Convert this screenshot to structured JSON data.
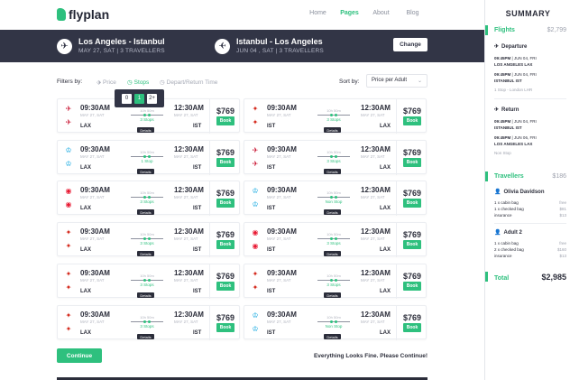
{
  "brand": "flyplan",
  "nav": [
    "Home",
    "Pages",
    "About",
    "Blog"
  ],
  "route_out": {
    "title": "Los Angeles - Istanbul",
    "date": "MAY 27, SAT",
    "travellers": "3 TRAVELLERS"
  },
  "route_back": {
    "title": "Istanbul - Los Angeles",
    "date": "JUN 04 , SAT",
    "travellers": "3 TRAVELLERS"
  },
  "change_label": "Change",
  "filters": {
    "label": "Filters by:",
    "price": "Price",
    "stops": "Stops",
    "depart": "Depart/Return Time",
    "sort_label": "Sort by:",
    "sort_value": "Price per Adult"
  },
  "stop_options": [
    "0",
    "1",
    "2+"
  ],
  "cards": [
    {
      "airline": "Turkish",
      "icon": "plane-tail-icon",
      "time_a": "09:30AM",
      "time_b": "12:30AM",
      "date": "MAY 27, SAT",
      "from": "LAX",
      "to": "IST",
      "duration": "10h 50m",
      "stops": "3 Stops",
      "details": "Details",
      "price": "$769",
      "book": "Book"
    },
    {
      "airline": "Air Canada",
      "icon": "maple-leaf-icon",
      "time_a": "09:30AM",
      "time_b": "12:30AM",
      "date": "MAY 27, SAT",
      "from": "IST",
      "to": "LAX",
      "duration": "10h 50m",
      "stops": "3 Stops",
      "details": "Details",
      "price": "$769",
      "book": "Book"
    },
    {
      "airline": "KLM",
      "icon": "klm-icon",
      "time_a": "09:30AM",
      "time_b": "12:30AM",
      "date": "MAY 27, SAT",
      "from": "LAX",
      "to": "IST",
      "duration": "10h 50m",
      "stops": "1 Stop",
      "details": "Details",
      "price": "$769",
      "book": "Book"
    },
    {
      "airline": "American",
      "icon": "plane-tail-icon",
      "time_a": "09:30AM",
      "time_b": "12:30AM",
      "date": "MAY 27, SAT",
      "from": "IST",
      "to": "LAX",
      "duration": "10h 50m",
      "stops": "3 Stops",
      "details": "Details",
      "price": "$769",
      "book": "Book"
    },
    {
      "airline": "Turkish",
      "icon": "circle-logo-icon",
      "time_a": "09:30AM",
      "time_b": "12:30AM",
      "date": "MAY 27, SAT",
      "from": "LAX",
      "to": "IST",
      "duration": "10h 50m",
      "stops": "3 Stops",
      "details": "Details",
      "price": "$769",
      "book": "Book"
    },
    {
      "airline": "KLM",
      "icon": "klm-icon",
      "time_a": "09:30AM",
      "time_b": "12:30AM",
      "date": "MAY 27, SAT",
      "from": "IST",
      "to": "LAX",
      "duration": "10h 50m",
      "stops": "Non Stop",
      "details": "Details",
      "price": "$769",
      "book": "Book"
    },
    {
      "airline": "Air Canada",
      "icon": "maple-leaf-icon",
      "time_a": "09:30AM",
      "time_b": "12:30AM",
      "date": "MAY 27, SAT",
      "from": "LAX",
      "to": "IST",
      "duration": "10h 50m",
      "stops": "3 Stops",
      "details": "Details",
      "price": "$769",
      "book": "Book"
    },
    {
      "airline": "Turkish",
      "icon": "circle-logo-icon",
      "time_a": "09:30AM",
      "time_b": "12:30AM",
      "date": "MAY 27, SAT",
      "from": "IST",
      "to": "LAX",
      "duration": "10h 50m",
      "stops": "3 Stops",
      "details": "Details",
      "price": "$769",
      "book": "Book"
    },
    {
      "airline": "Air Canada",
      "icon": "maple-leaf-icon",
      "time_a": "09:30AM",
      "time_b": "12:30AM",
      "date": "MAY 27, SAT",
      "from": "LAX",
      "to": "IST",
      "duration": "10h 50m",
      "stops": "3 Stops",
      "details": "Details",
      "price": "$769",
      "book": "Book"
    },
    {
      "airline": "Air Canada",
      "icon": "maple-leaf-icon",
      "time_a": "09:30AM",
      "time_b": "12:30AM",
      "date": "MAY 27, SAT",
      "from": "IST",
      "to": "LAX",
      "duration": "10h 50m",
      "stops": "3 Stops",
      "details": "Details",
      "price": "$769",
      "book": "Book"
    },
    {
      "airline": "Air Canada",
      "icon": "maple-leaf-icon",
      "time_a": "09:30AM",
      "time_b": "12:30AM",
      "date": "MAY 27, SAT",
      "from": "LAX",
      "to": "IST",
      "duration": "10h 50m",
      "stops": "3 Stops",
      "details": "Details",
      "price": "$769",
      "book": "Book"
    },
    {
      "airline": "KLM",
      "icon": "klm-icon",
      "time_a": "09:30AM",
      "time_b": "12:30AM",
      "date": "MAY 27, SAT",
      "from": "IST",
      "to": "LAX",
      "duration": "10h 50m",
      "stops": "Non Stop",
      "details": "Details",
      "price": "$769",
      "book": "Book"
    }
  ],
  "continue_label": "Continue",
  "fine_label": "Everything Looks Fine. Please Continue!",
  "summary": {
    "title": "SUMMARY",
    "flights_label": "Flights",
    "flights_total": "$2,799",
    "departure": {
      "label": "Departure",
      "l1a": "09:45PM",
      "l1b": "JUN 04, FRI",
      "l1c": "LOS ANGELES LAX",
      "l2a": "09:45PM",
      "l2b": "JUN 04, FRI",
      "l2c": "ISTANBUL IST",
      "note": "1 Stop - London LHR"
    },
    "return": {
      "label": "Return",
      "l1a": "09:45PM",
      "l1b": "JUN 04, FRI",
      "l1c": "ISTANBUL IST",
      "l2a": "09:45PM",
      "l2b": "JUN 06, FRI",
      "l2c": "LOS ANGELES LAX",
      "note": "Non Stop"
    },
    "travellers_label": "Travellers",
    "travellers_total": "$186",
    "pax1": {
      "name": "Olivia Davidson",
      "r1": "1 x cabin bag",
      "v1": "free",
      "r2": "1 x checked bag",
      "v2": "$81",
      "r3": "insurance",
      "v3": "$13"
    },
    "pax2": {
      "name": "Adult 2",
      "r1": "1 x cabin bag",
      "v1": "free",
      "r2": "2 x checked bag",
      "v2": "$160",
      "r3": "insurance",
      "v3": "$13"
    },
    "total_label": "Total",
    "total_value": "$2,985"
  },
  "colors": {
    "accent": "#2ec07e",
    "dark": "#323546"
  }
}
